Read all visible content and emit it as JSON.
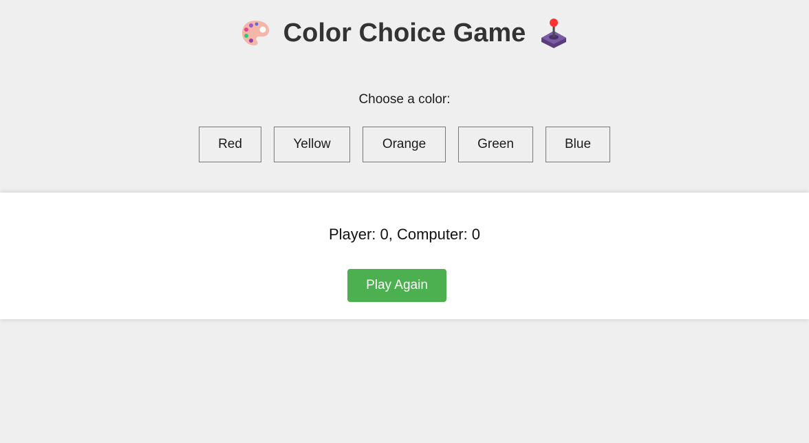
{
  "header": {
    "title": "Color Choice Game",
    "left_icon": "artist-palette-icon",
    "right_icon": "joystick-icon"
  },
  "prompt": "Choose a color:",
  "choices": [
    "Red",
    "Yellow",
    "Orange",
    "Green",
    "Blue"
  ],
  "result": {
    "score_text": "Player: 0, Computer: 0",
    "play_again_label": "Play Again"
  },
  "colors": {
    "page_background": "#efefef",
    "panel_background": "#ffffff",
    "play_again_background": "#4caf50",
    "title_text": "#333333"
  }
}
